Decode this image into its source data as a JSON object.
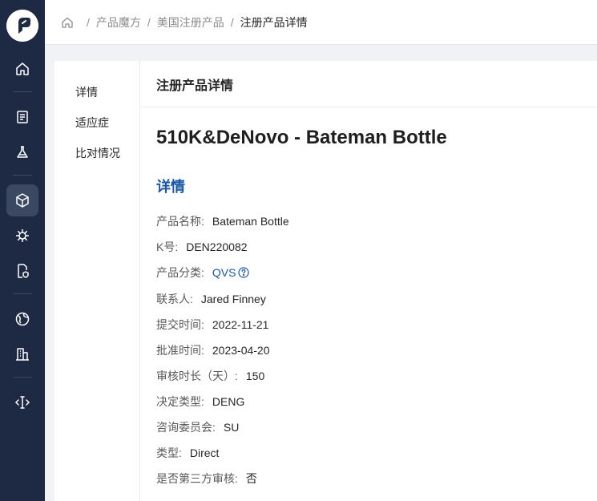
{
  "breadcrumb": [
    "产品魔方",
    "美国注册产品",
    "注册产品详情"
  ],
  "anchor_nav": [
    "详情",
    "适应症",
    "比对情况"
  ],
  "header": {
    "title": "注册产品详情"
  },
  "product": {
    "title": "510K&DeNovo - Bateman Bottle"
  },
  "section": {
    "title": "详情"
  },
  "fields": [
    {
      "label": "产品名称:",
      "value": "Bateman Bottle"
    },
    {
      "label": "K号:",
      "value": "DEN220082"
    },
    {
      "label": "产品分类:",
      "value": "QVS"
    },
    {
      "label": "联系人:",
      "value": "Jared Finney"
    },
    {
      "label": "提交时间:",
      "value": "2022-11-21"
    },
    {
      "label": "批准时间:",
      "value": "2023-04-20"
    },
    {
      "label": "审核时长（天）:",
      "value": "150"
    },
    {
      "label": "决定类型:",
      "value": "DENG"
    },
    {
      "label": "咨询委员会:",
      "value": "SU"
    },
    {
      "label": "类型:",
      "value": "Direct"
    },
    {
      "label": "是否第三方审核:",
      "value": "否"
    }
  ],
  "icons": {
    "sidebar": [
      "home-icon",
      "document-icon",
      "flask-icon",
      "cube-icon",
      "virus-icon",
      "file-shield-icon",
      "globe-icon",
      "building-icon",
      "text-cursor-icon"
    ],
    "help": "help-circle-icon"
  },
  "colors": {
    "sidebar": "#1e2a44",
    "active": "#3a4862",
    "link": "#1a56a6"
  }
}
